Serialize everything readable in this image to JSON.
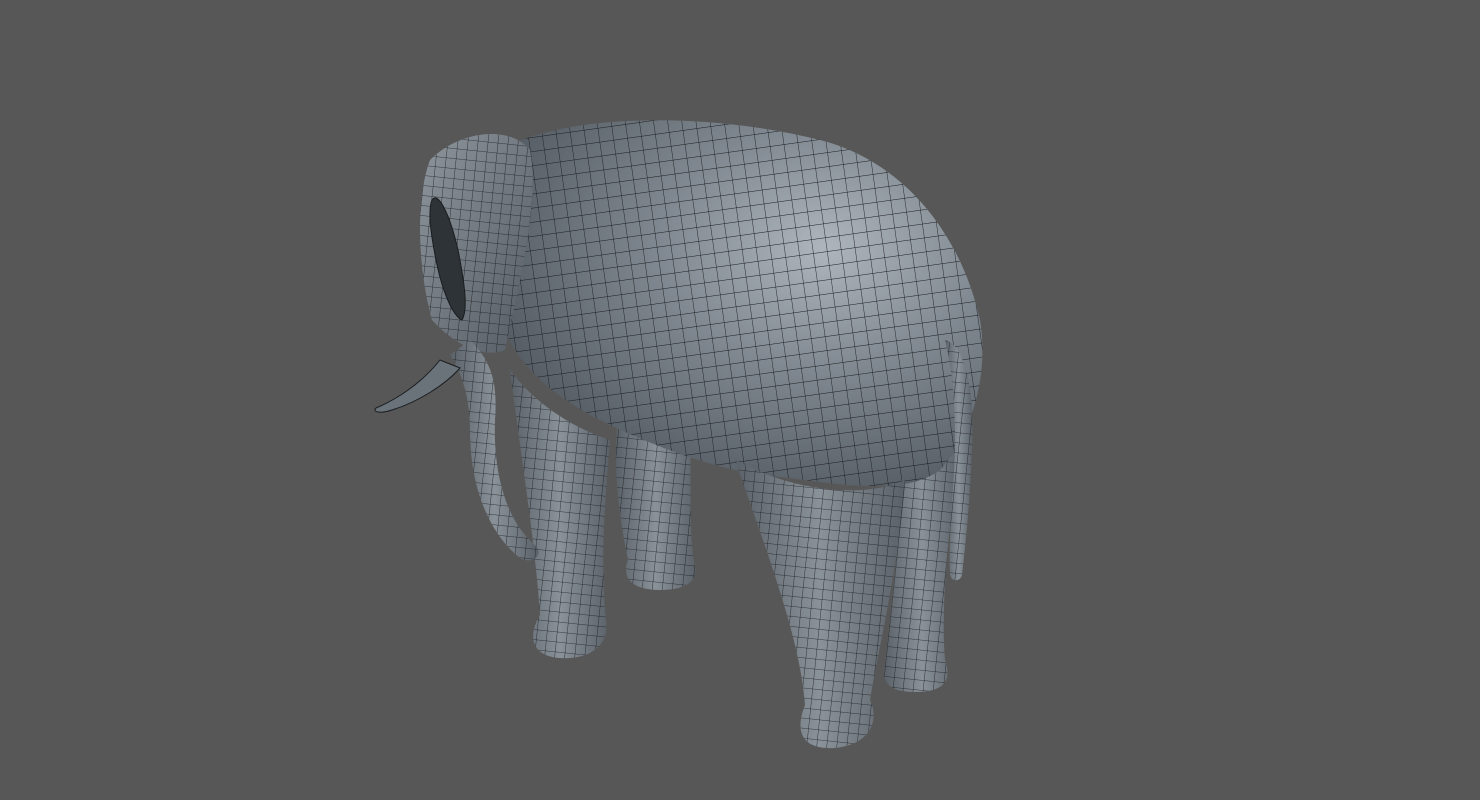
{
  "viewport": {
    "background_color": "#575757",
    "mesh_color": "#6f7880",
    "mesh_shadow_color": "#4a5056",
    "mesh_highlight_color": "#aeb5bd",
    "wireframe_color": "#1a1d20",
    "subject": "elephant-wireframe-model"
  }
}
